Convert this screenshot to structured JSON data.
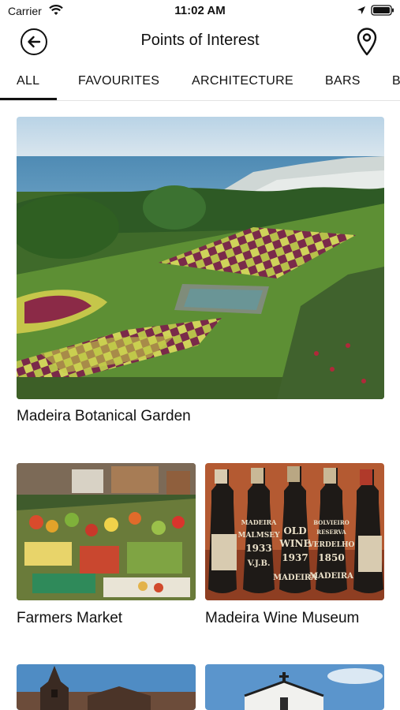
{
  "status_bar": {
    "carrier": "Carrier",
    "time": "11:02 AM",
    "icons": [
      "wifi-icon",
      "location-arrow-icon",
      "battery-icon"
    ]
  },
  "nav": {
    "title": "Points of Interest",
    "back_icon": "back-arrow-icon",
    "map_icon": "map-pin-icon"
  },
  "tabs": [
    {
      "label": "ALL",
      "selected": true
    },
    {
      "label": "FAVOURITES",
      "selected": false
    },
    {
      "label": "ARCHITECTURE",
      "selected": false
    },
    {
      "label": "BARS",
      "selected": false
    },
    {
      "label": "B",
      "selected": false
    }
  ],
  "places": [
    {
      "title": "Madeira Botanical Garden",
      "image": "botanical-garden-photo"
    },
    {
      "title": "Farmers Market",
      "image": "farmers-market-photo"
    },
    {
      "title": "Madeira Wine Museum",
      "image": "wine-museum-photo"
    },
    {
      "title": "",
      "image": "cathedral-photo"
    },
    {
      "title": "",
      "image": "church-photo"
    }
  ],
  "wine_labels": [
    "MADEIRA",
    "MALMSEY",
    "1933",
    "V.J.B.",
    "OLD",
    "WINE",
    "1937",
    "MADEIRA",
    "BOLVIEIRO",
    "RESERVA",
    "VERDELHO",
    "1850",
    "MADEIRA"
  ],
  "colors": {
    "text": "#111111",
    "tab_indicator": "#111111",
    "background": "#ffffff"
  }
}
